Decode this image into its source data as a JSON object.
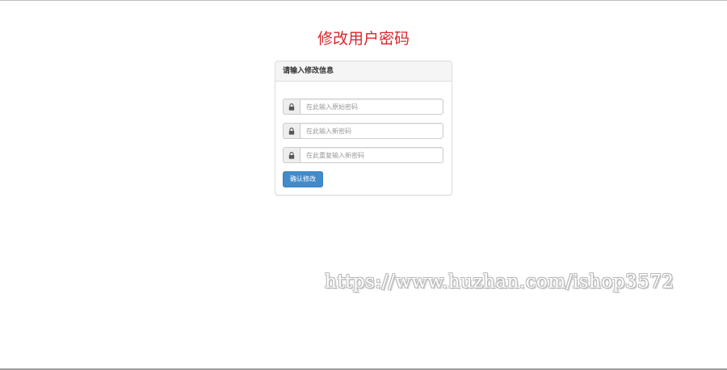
{
  "page": {
    "title": "修改用户密码"
  },
  "form": {
    "heading": "请输入修改信息",
    "fields": [
      {
        "placeholder": "在此输入原始密码",
        "icon": "lock-icon"
      },
      {
        "placeholder": "在此输入新密码",
        "icon": "lock-icon"
      },
      {
        "placeholder": "在此重复输入新密码",
        "icon": "lock-icon"
      }
    ],
    "submit_label": "确认修改"
  },
  "watermark": {
    "text": "https://www.huzhan.com/ishop3572"
  },
  "colors": {
    "title": "#d9262c",
    "primary_button": "#428bca",
    "panel_heading_bg": "#f5f5f5"
  }
}
